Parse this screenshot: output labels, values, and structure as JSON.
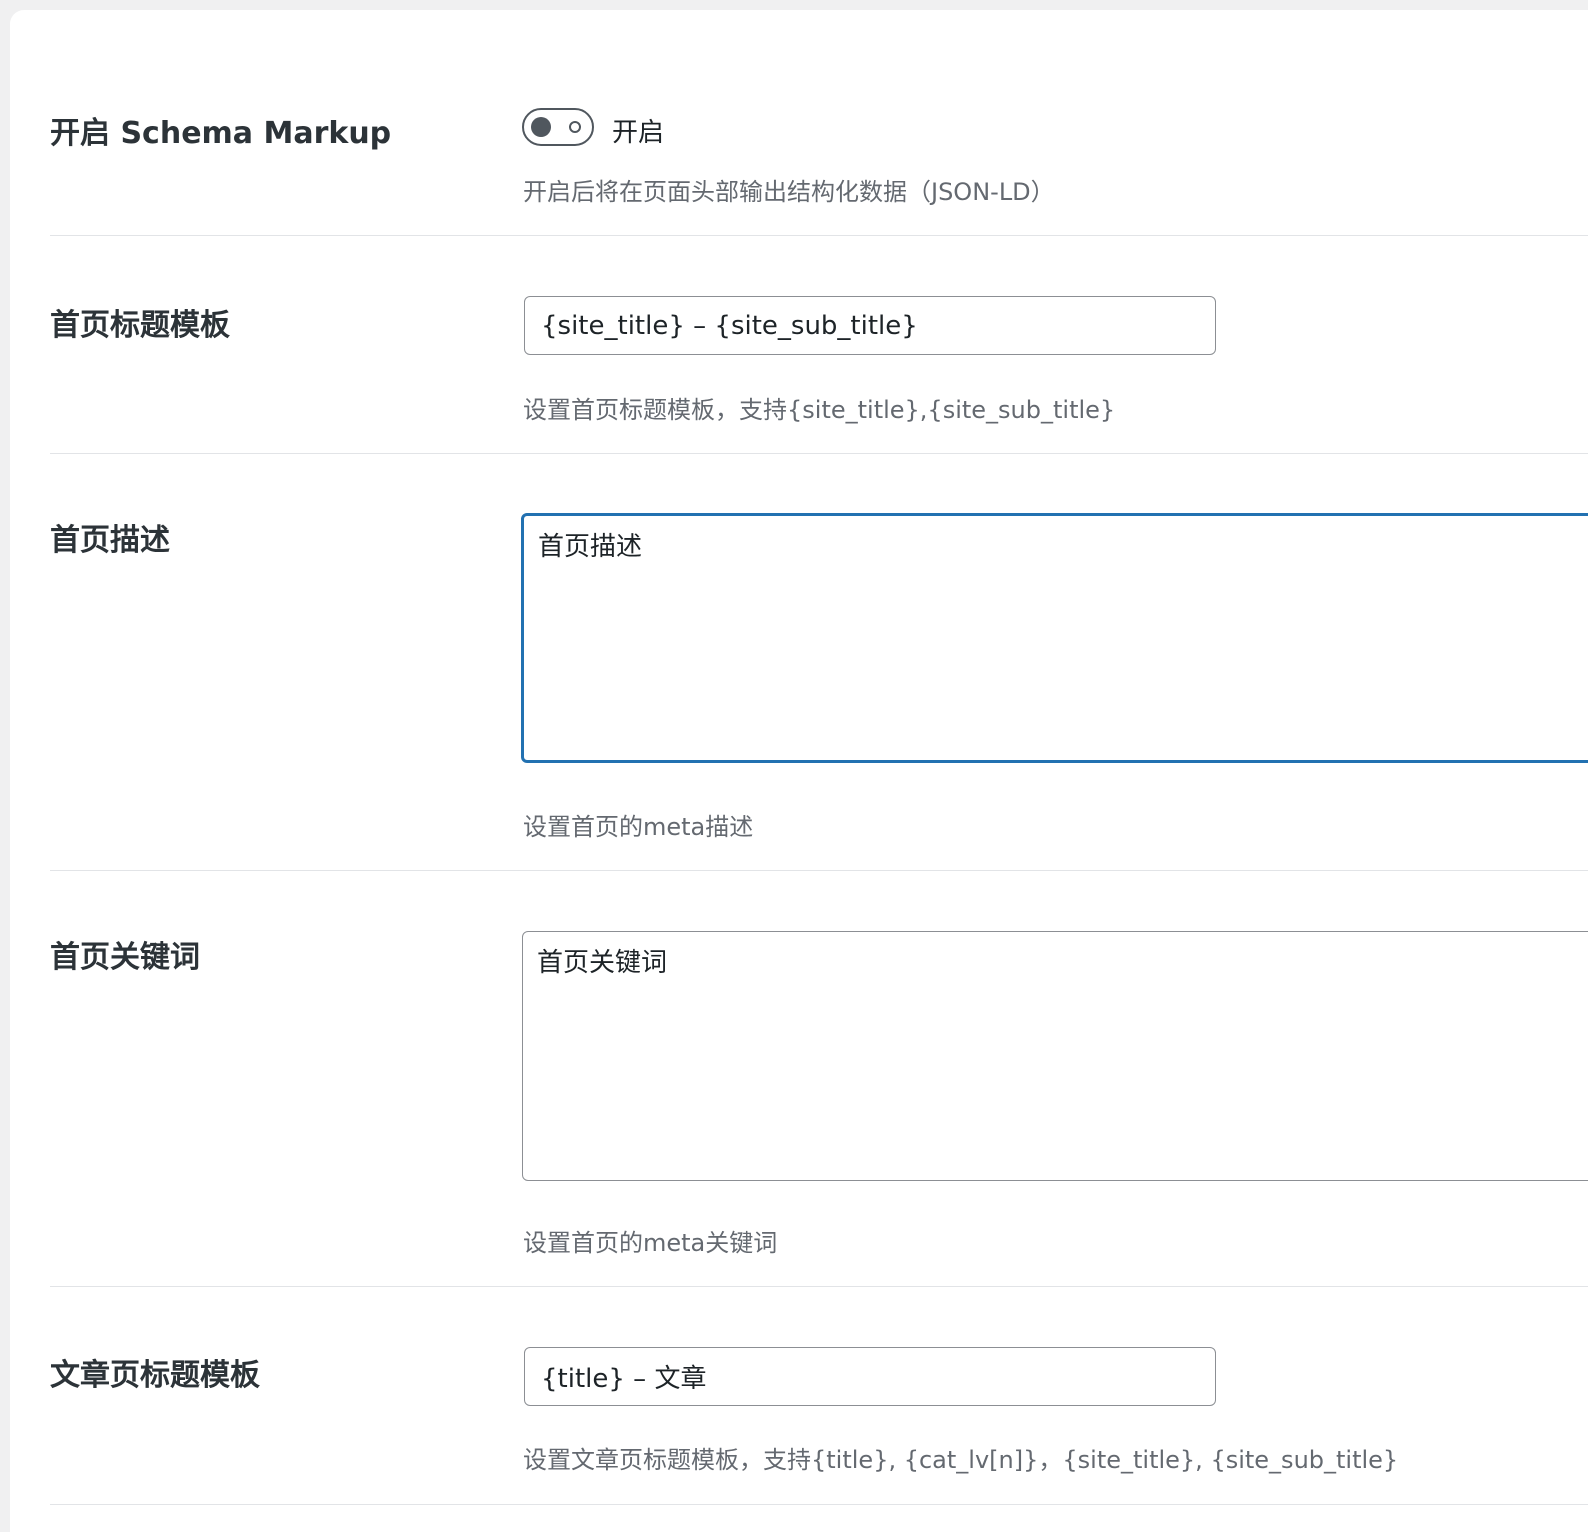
{
  "settings": {
    "schema": {
      "label": "开启 Schema Markup",
      "toggle_label": "开启",
      "toggle_on": false,
      "description": "开启后将在页面头部输出结构化数据（JSON-LD）"
    },
    "home_title": {
      "label": "首页标题模板",
      "value": "{site_title} – {site_sub_title}",
      "description": "设置首页标题模板，支持{site_title},{site_sub_title}"
    },
    "home_description": {
      "label": "首页描述",
      "value": "首页描述",
      "description": "设置首页的meta描述"
    },
    "home_keywords": {
      "label": "首页关键词",
      "value": "首页关键词",
      "description": "设置首页的meta关键词"
    },
    "post_title": {
      "label": "文章页标题模板",
      "value": "{title} – 文章",
      "description": "设置文章页标题模板，支持{title}, {cat_lv[n]}，{site_title}, {site_sub_title}"
    }
  },
  "colors": {
    "focus_border": "#2271b1",
    "label_text": "#2c3338",
    "description_text": "#646970",
    "divider": "#e2e4e7"
  }
}
